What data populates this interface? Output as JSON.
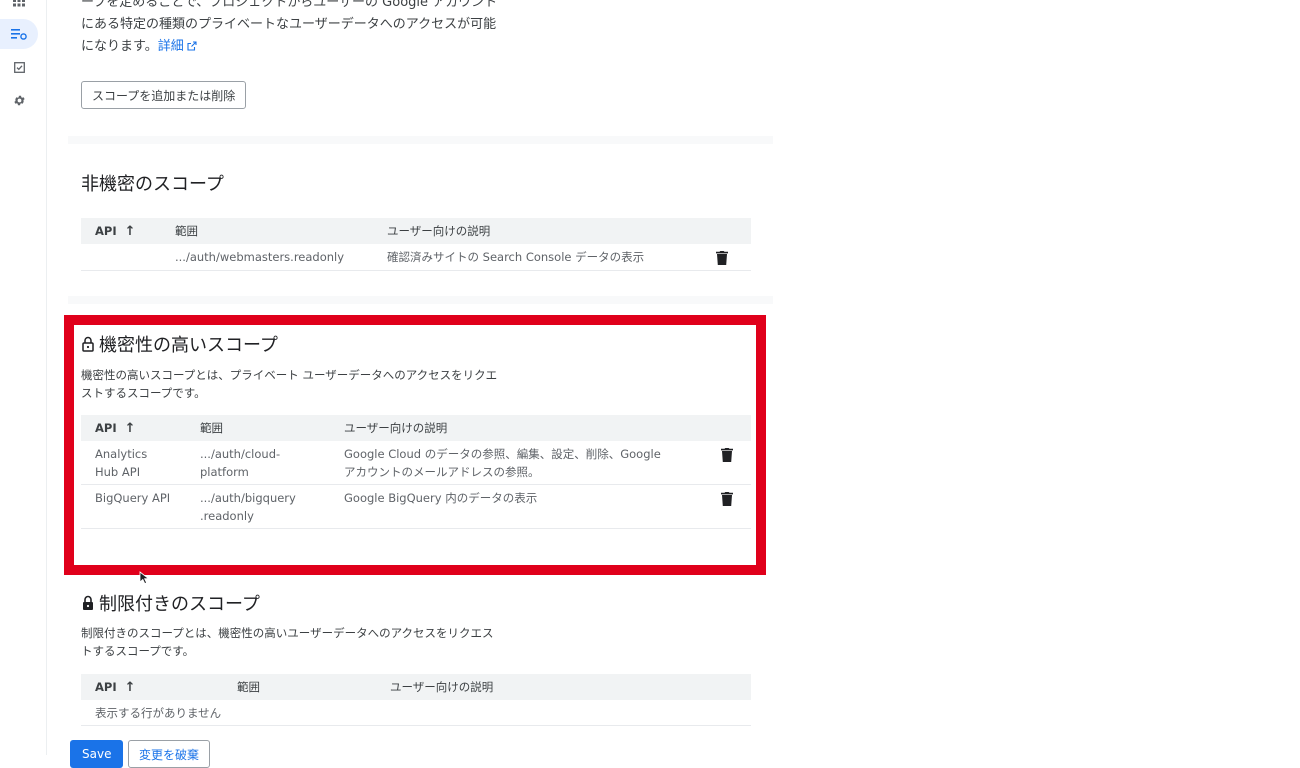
{
  "intro": {
    "line1": "ープを定めることで、プロジェクトからユーザーの Google アカウント",
    "line2": "にある特定の種類のプライベートなユーザーデータへのアクセスが可能",
    "line3_prefix": "になります。",
    "learn_more": "詳細"
  },
  "add_remove_scopes_button": "スコープを追加または削除",
  "non_sensitive": {
    "title": "非機密のスコープ",
    "headers": {
      "api": "API",
      "scope": "範囲",
      "description": "ユーザー向けの説明"
    },
    "rows": [
      {
        "api": "",
        "scope": ".../auth/webmasters.readonly",
        "description": "確認済みサイトの Search Console データの表示"
      }
    ]
  },
  "sensitive": {
    "title": "機密性の高いスコープ",
    "desc_line1": "機密性の高いスコープとは、プライベート ユーザーデータへのアクセスをリクエ",
    "desc_line2": "ストするスコープです。",
    "headers": {
      "api": "API",
      "scope": "範囲",
      "description": "ユーザー向けの説明"
    },
    "rows": [
      {
        "api_line1": "Analytics",
        "api_line2": "Hub API",
        "scope_line1": ".../auth/cloud-",
        "scope_line2": "platform",
        "desc_line1": "Google Cloud のデータの参照、編集、設定、削除、Google",
        "desc_line2": "アカウントのメールアドレスの参照。"
      },
      {
        "api_line1": "BigQuery API",
        "api_line2": "",
        "scope_line1": ".../auth/bigquery",
        "scope_line2": ".readonly",
        "desc_line1": "Google BigQuery 内のデータの表示",
        "desc_line2": ""
      }
    ]
  },
  "restricted": {
    "title": "制限付きのスコープ",
    "desc_line1": "制限付きのスコープとは、機密性の高いユーザーデータへのアクセスをリクエス",
    "desc_line2": "トするスコープです。",
    "headers": {
      "api": "API",
      "scope": "範囲",
      "description": "ユーザー向けの説明"
    },
    "empty": "表示する行がありません"
  },
  "footer": {
    "save": "Save",
    "discard": "変更を破棄"
  },
  "colors": {
    "highlight": "#e0001b",
    "primary": "#1a73e8"
  },
  "icons": [
    "apps-icon",
    "oauth-consent-icon",
    "verification-icon",
    "settings-icon",
    "lock-open-icon",
    "lock-icon",
    "delete-icon",
    "external-link-icon",
    "arrow-up-icon"
  ]
}
